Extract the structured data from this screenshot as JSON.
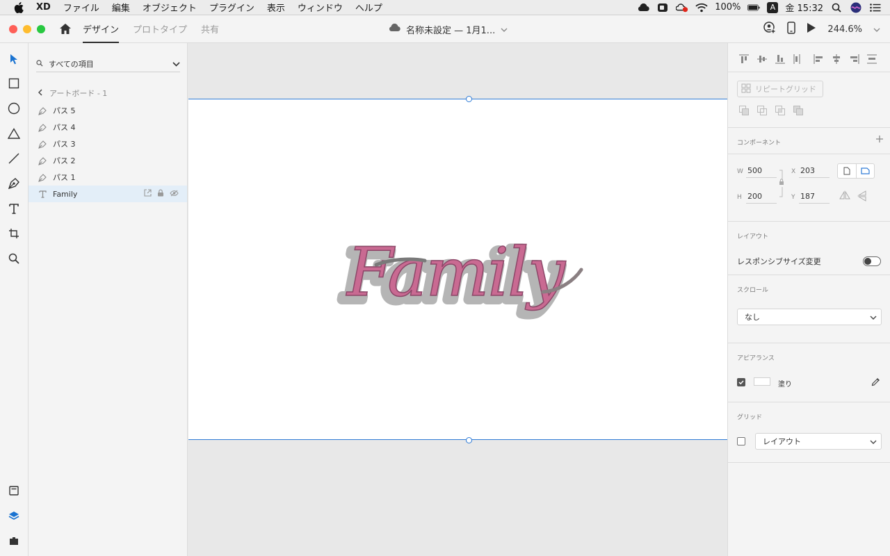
{
  "menubar": {
    "app_name": "XD",
    "items": [
      "ファイル",
      "編集",
      "オブジェクト",
      "プラグイン",
      "表示",
      "ウィンドウ",
      "ヘルプ"
    ],
    "battery": "100%",
    "input_indicator": "A",
    "clock": "金 15:32"
  },
  "titlebar": {
    "tabs": [
      "デザイン",
      "プロトタイプ",
      "共有"
    ],
    "active_tab": "デザイン",
    "document_title": "名称未設定 — 1月1...",
    "zoom": "244.6%"
  },
  "layers": {
    "search_placeholder": "すべての項目",
    "breadcrumb": "アートボード - 1",
    "items": [
      {
        "label": "パス 5",
        "type": "path"
      },
      {
        "label": "パス 4",
        "type": "path"
      },
      {
        "label": "パス 3",
        "type": "path"
      },
      {
        "label": "パス 2",
        "type": "path"
      },
      {
        "label": "パス 1",
        "type": "path"
      },
      {
        "label": "Family",
        "type": "text",
        "selected": true
      }
    ]
  },
  "canvas": {
    "art_text": "Family",
    "art_fill_color": "#c96a92",
    "art_shadow_color": "#b5b5b5"
  },
  "props": {
    "repeat_grid": "リピートグリッド",
    "component_title": "コンポーネント",
    "w_label": "W",
    "w_value": "500",
    "h_label": "H",
    "h_value": "200",
    "x_label": "X",
    "x_value": "203",
    "y_label": "Y",
    "y_value": "187",
    "layout_title": "レイアウト",
    "responsive_label": "レスポンシブサイズ変更",
    "responsive_enabled": false,
    "scroll_title": "スクロール",
    "scroll_value": "なし",
    "appearance_title": "アピアランス",
    "fill_label": "塗り",
    "fill_enabled": true,
    "grid_title": "グリッド",
    "grid_enabled": false,
    "grid_value": "レイアウト"
  },
  "colors": {
    "accent": "#2d7ad6",
    "panel_bg": "#f4f4f4",
    "canvas_bg": "#e8e8e8"
  }
}
